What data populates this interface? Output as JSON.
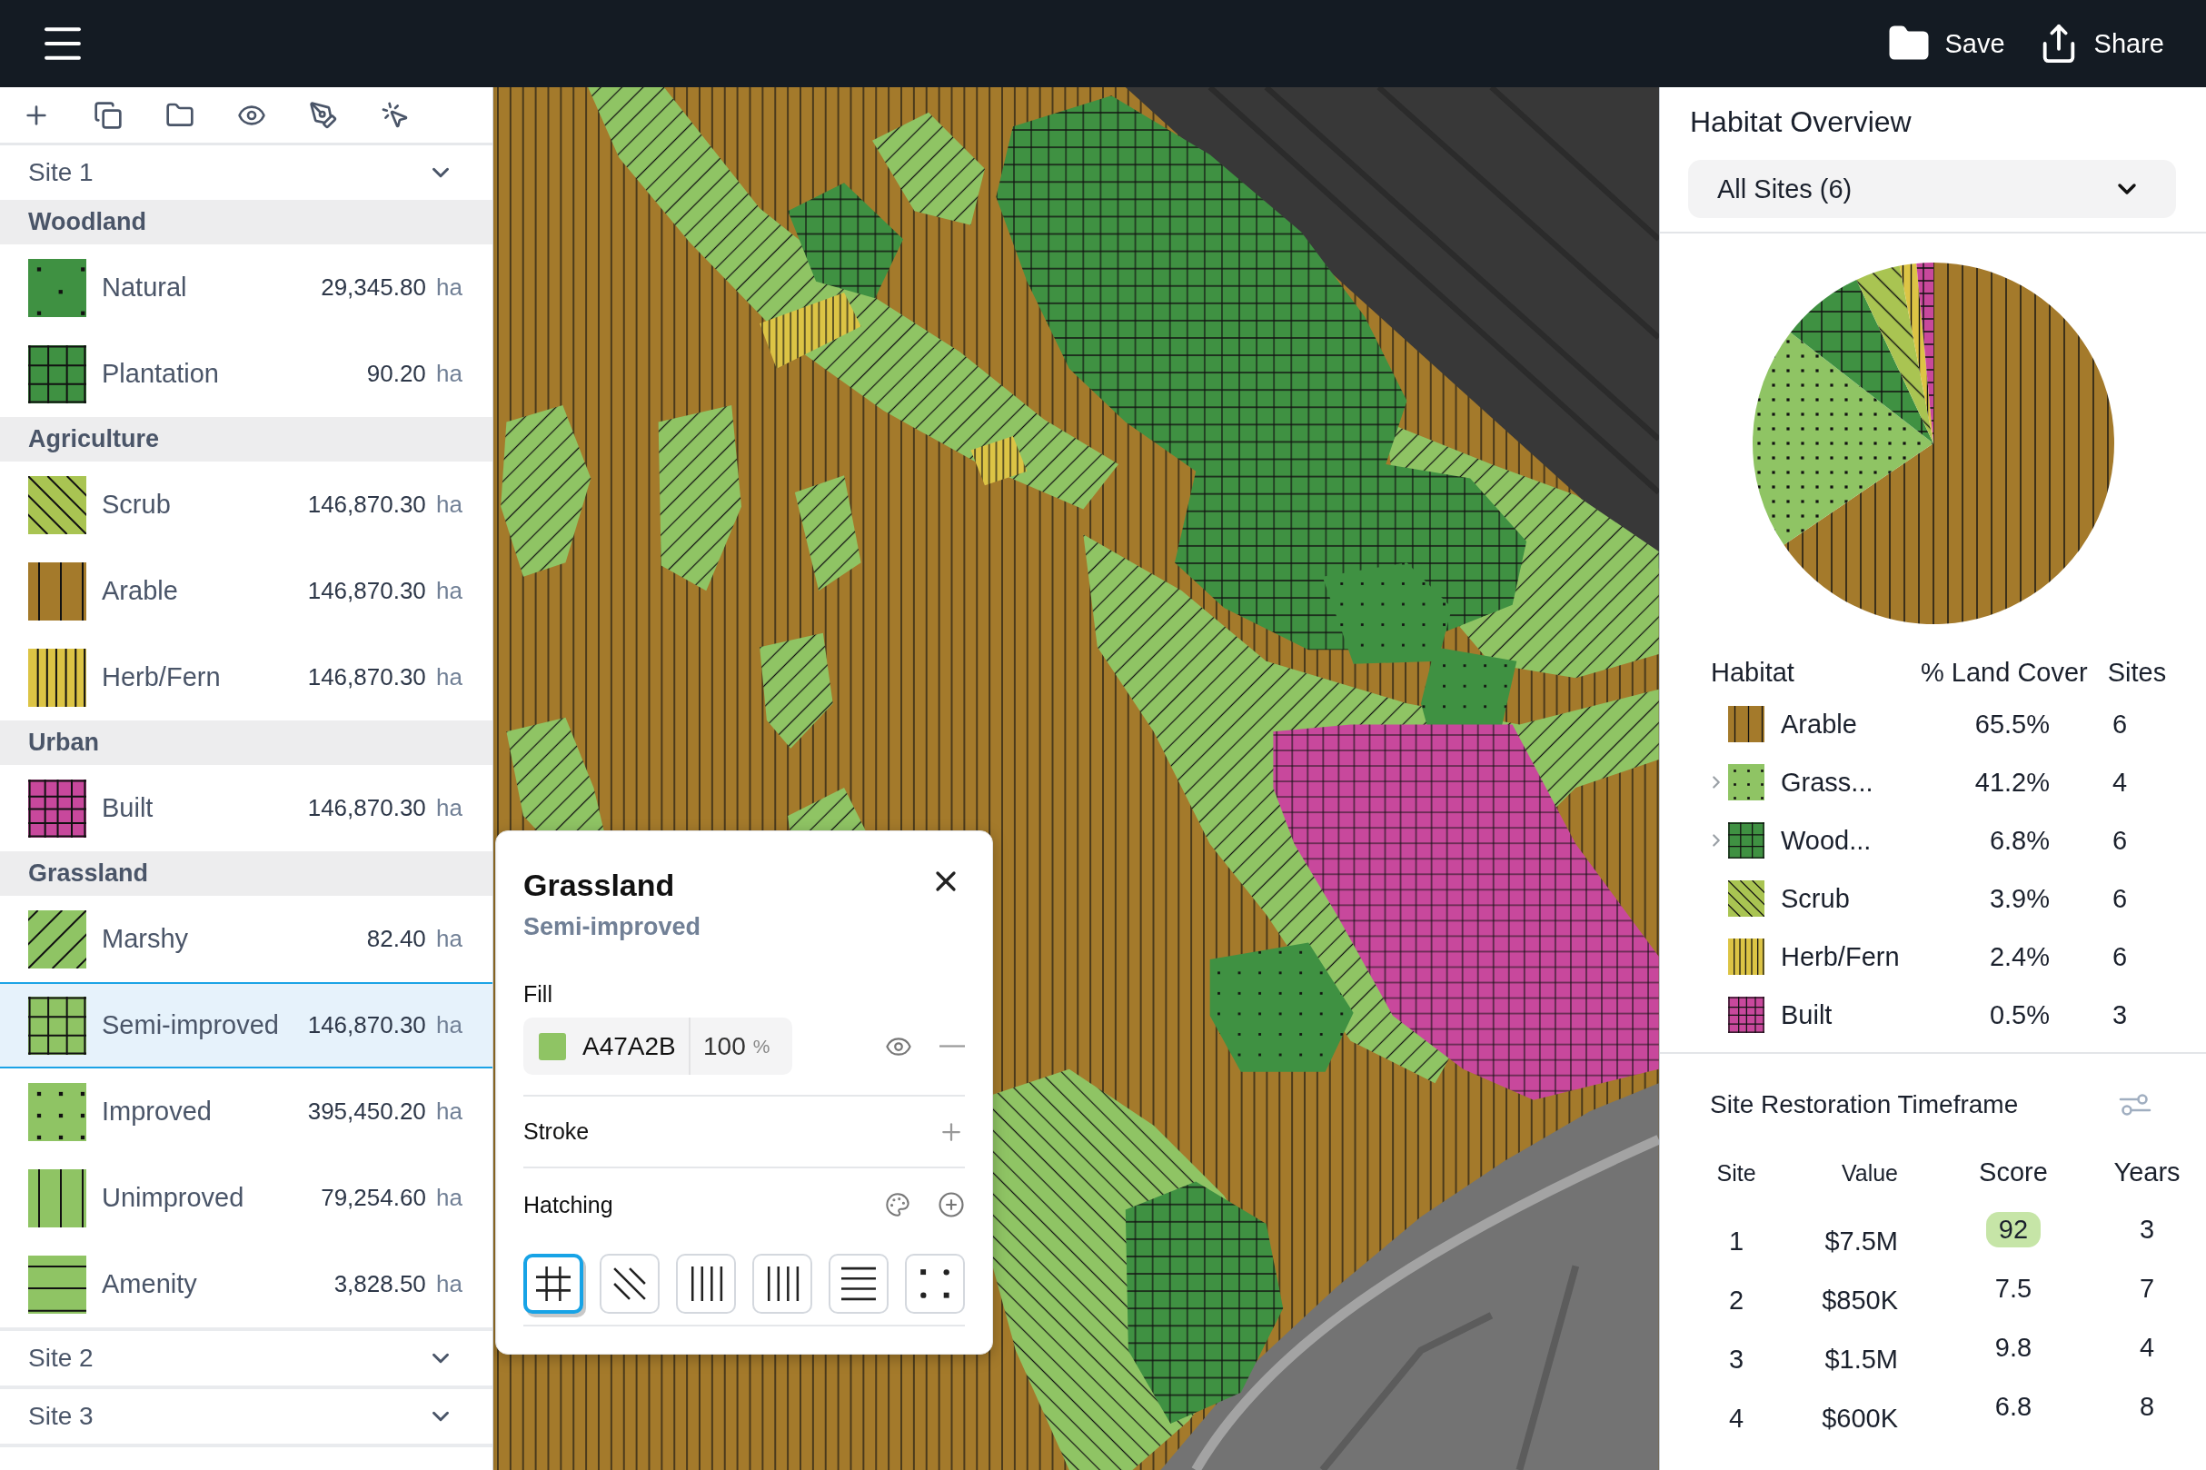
{
  "topbar": {
    "actions": [
      {
        "kind": "save",
        "label": "Save"
      },
      {
        "kind": "share",
        "label": "Share"
      }
    ]
  },
  "sidebar": {
    "sites": [
      {
        "name": "Site 1",
        "groups": [
          {
            "name": "Woodland",
            "items": [
              {
                "name": "Natural",
                "area": "29,345.80",
                "unit": "ha",
                "kind": "sparse",
                "color": "#3f9142",
                "selected": false
              },
              {
                "name": "Plantation",
                "area": "90.20",
                "unit": "ha",
                "kind": "grid",
                "color": "#3f9142",
                "selected": false
              }
            ]
          },
          {
            "name": "Agriculture",
            "items": [
              {
                "name": "Scrub",
                "area": "146,870.30",
                "unit": "ha",
                "kind": "backslash",
                "color": "#a9c452",
                "selected": false
              },
              {
                "name": "Arable",
                "area": "146,870.30",
                "unit": "ha",
                "kind": "vertical",
                "color": "#a47a2b",
                "selected": false
              },
              {
                "name": "Herb/Fern",
                "area": "146,870.30",
                "unit": "ha",
                "kind": "dense",
                "color": "#dcc445",
                "selected": false
              }
            ]
          },
          {
            "name": "Urban",
            "items": [
              {
                "name": "Built",
                "area": "146,870.30",
                "unit": "ha",
                "kind": "mesh",
                "color": "#c8489c",
                "selected": false
              }
            ]
          },
          {
            "name": "Grassland",
            "items": [
              {
                "name": "Marshy",
                "area": "82.40",
                "unit": "ha",
                "kind": "slash",
                "color": "#8fc464",
                "selected": false
              },
              {
                "name": "Semi-improved",
                "area": "146,870.30",
                "unit": "ha",
                "kind": "grid",
                "color": "#8fc464",
                "selected": true
              },
              {
                "name": "Improved",
                "area": "395,450.20",
                "unit": "ha",
                "kind": "dots",
                "color": "#8fc464",
                "selected": false
              },
              {
                "name": "Unimproved",
                "area": "79,254.60",
                "unit": "ha",
                "kind": "vertical",
                "color": "#8fc464",
                "selected": false
              },
              {
                "name": "Amenity",
                "area": "3,828.50",
                "unit": "ha",
                "kind": "horizontal",
                "color": "#8fc464",
                "selected": false
              }
            ]
          }
        ]
      },
      {
        "name": "Site 2"
      },
      {
        "name": "Site 3"
      }
    ]
  },
  "popup": {
    "title": "Grassland",
    "subtitle": "Semi-improved",
    "fill": {
      "label": "Fill",
      "hex": "A47A2B",
      "opacity": "100",
      "unit": "%",
      "visible": true
    },
    "stroke": {
      "label": "Stroke"
    },
    "hatching": {
      "label": "Hatching",
      "options": [
        {
          "kind": "grid",
          "selected": true
        },
        {
          "kind": "backslash",
          "selected": false
        },
        {
          "kind": "vertical",
          "selected": false
        },
        {
          "kind": "vertical",
          "selected": false
        },
        {
          "kind": "horizontal",
          "selected": false
        },
        {
          "kind": "dots",
          "selected": false
        }
      ]
    }
  },
  "overview": {
    "title": "Habitat Overview",
    "select": {
      "value": "All Sites (6)"
    },
    "chart_data": {
      "type": "pie",
      "categories": [
        "Arable",
        "Grass...",
        "Wood...",
        "Scrub",
        "Herb/Fern",
        "Built"
      ],
      "values": [
        65.5,
        20,
        7.5,
        4,
        1.5,
        1.5
      ]
    },
    "columns": [
      "Habitat",
      "% Land Cover",
      "Sites"
    ],
    "rows": [
      {
        "kind": "vertical",
        "color": "#a47a2b",
        "cover": "65.5%",
        "sites": "6"
      },
      {
        "kind": "dots",
        "color": "#8fc464",
        "cover": "41.2%",
        "sites": "4",
        "expanded": false
      },
      {
        "kind": "grid",
        "color": "#3f9142",
        "cover": "6.8%",
        "sites": "6",
        "expanded": false
      },
      {
        "kind": "backslash",
        "color": "#a9c452",
        "cover": "3.9%",
        "sites": "6"
      },
      {
        "kind": "dense",
        "color": "#dcc445",
        "cover": "2.4%",
        "sites": "6"
      },
      {
        "kind": "mesh",
        "color": "#c8489c",
        "cover": "0.5%",
        "sites": "3"
      }
    ]
  },
  "restoration": {
    "title": "Site Restoration Timeframe",
    "columns": [
      "Site",
      "Value",
      "Score",
      "Years"
    ],
    "rows": [
      {
        "site": "1",
        "value": "$7.5M",
        "score": "92",
        "years": "3",
        "highlighted": true
      },
      {
        "site": "2",
        "value": "$850K",
        "score": "7.5",
        "years": "7",
        "highlighted": false
      },
      {
        "site": "3",
        "value": "$1.5M",
        "score": "9.8",
        "years": "4",
        "highlighted": false
      },
      {
        "site": "4",
        "value": "$600K",
        "score": "6.8",
        "years": "8",
        "highlighted": false
      }
    ]
  }
}
